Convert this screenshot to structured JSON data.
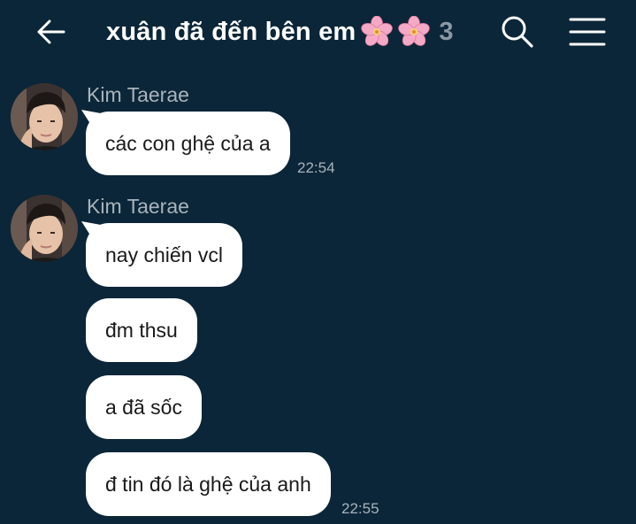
{
  "header": {
    "title": "xuân đã đến bên em",
    "member_count": "3",
    "icons": {
      "back": "arrow-left-icon",
      "flower": "cherry-blossom-emoji",
      "search": "search-icon",
      "menu": "hamburger-menu-icon"
    }
  },
  "messages": {
    "group1": {
      "sender": "Kim Taerae",
      "bubbles": [
        "các con ghệ của a"
      ],
      "time": "22:54"
    },
    "group2": {
      "sender": "Kim Taerae",
      "bubbles": [
        "nay chiến vcl",
        "đm thsu",
        "a đã sốc",
        "đ tin đó là ghệ của anh"
      ],
      "time": "22:55"
    }
  },
  "colors": {
    "background": "#0b2638",
    "bubble": "#ffffff",
    "muted_text": "#a8b3bc",
    "title": "#ffffff"
  }
}
